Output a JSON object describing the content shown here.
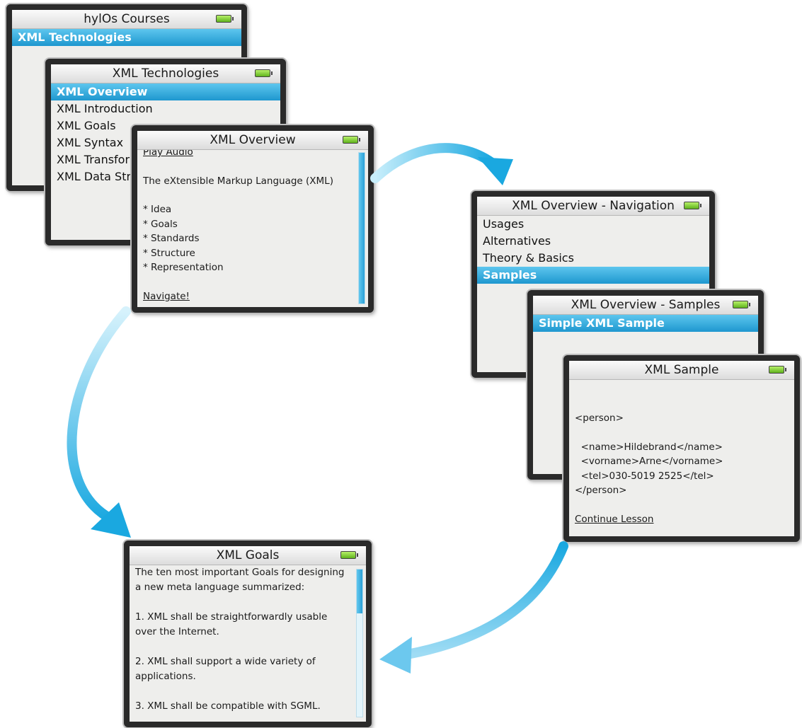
{
  "screens": {
    "courses": {
      "title": "hylOs Courses",
      "items": [
        "XML Technologies"
      ]
    },
    "technologies": {
      "title": "XML Technologies",
      "items": [
        "XML Overview",
        "XML Introduction",
        "XML Goals",
        "XML Syntax",
        "XML Transform",
        "XML Data Stru"
      ]
    },
    "overview": {
      "title": "XML Overview",
      "play_audio": "Play Audio",
      "intro": "The eXtensible Markup Language (XML)",
      "bullets": [
        "* Idea",
        "* Goals",
        "* Standards",
        "* Structure",
        "* Representation"
      ],
      "navigate": "Navigate!"
    },
    "navigation": {
      "title": "XML Overview - Navigation",
      "items": [
        "Usages",
        "Alternatives",
        "Theory & Basics",
        "Samples"
      ]
    },
    "samples": {
      "title": "XML Overview - Samples",
      "items": [
        "Simple XML Sample"
      ]
    },
    "sample": {
      "title": "XML Sample",
      "code": [
        "<person>",
        "",
        "  <name>Hildebrand</name>",
        "  <vorname>Arne</vorname>",
        "  <tel>030-5019 2525</tel>",
        "</person>"
      ],
      "continue": "Continue Lesson"
    },
    "goals": {
      "title": "XML Goals",
      "paragraphs": [
        "The ten most important Goals for designing a new meta language summarized:",
        "1.  XML shall be straightforwardly usable over the Internet.",
        "2.  XML shall support a wide variety of applications.",
        "3.  XML shall be compatible with SGML."
      ]
    }
  },
  "colors": {
    "selection": "#1e97cf",
    "arrow": "#2ab4e6",
    "bezel": "#2a2a2a",
    "battery": "#7cc83a"
  }
}
